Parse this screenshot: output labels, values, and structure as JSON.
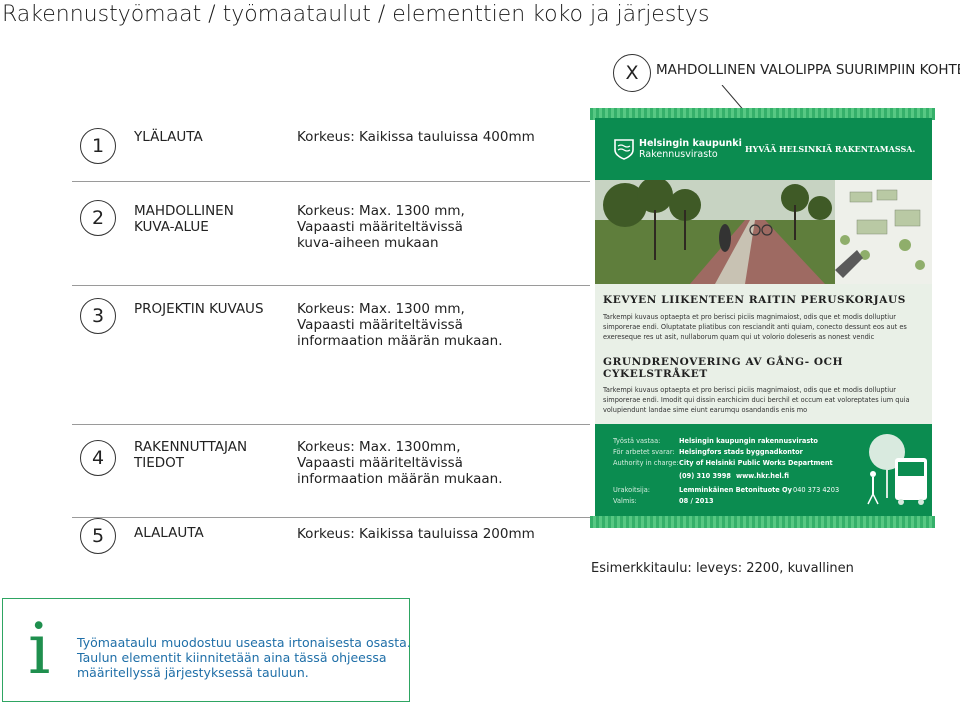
{
  "page": {
    "title": "Rakennustyömaat / työmaataulut / elementtien koko ja järjestys"
  },
  "optional": {
    "marker": "X",
    "label": "MAHDOLLINEN VALOLIPPA SUURIMPIIN KOHTEISIIN"
  },
  "rows": [
    {
      "num": "1",
      "label": [
        "YLÄLAUTA"
      ],
      "desc": [
        "Korkeus: Kaikissa tauluissa 400mm"
      ]
    },
    {
      "num": "2",
      "label": [
        "MAHDOLLINEN",
        "KUVA-ALUE"
      ],
      "desc": [
        "Korkeus: Max. 1300 mm,",
        "Vapaasti määriteltävissä",
        "kuva-aiheen mukaan"
      ]
    },
    {
      "num": "3",
      "label": [
        "PROJEKTIN KUVAUS"
      ],
      "desc": [
        "Korkeus: Max. 1300 mm,",
        "Vapaasti määriteltävissä",
        "informaation määrän mukaan."
      ]
    },
    {
      "num": "4",
      "label": [
        "RAKENNUTTAJAN",
        "TIEDOT"
      ],
      "desc": [
        "Korkeus: Max. 1300mm,",
        "Vapaasti määriteltävissä",
        "informaation määrän mukaan."
      ]
    },
    {
      "num": "5",
      "label": [
        "ALALAUTA"
      ],
      "desc": [
        "Korkeus: Kaikissa tauluissa 200mm"
      ]
    }
  ],
  "sign": {
    "logo_line1": "Helsingin kaupunki",
    "logo_line2": "Rakennusvirasto",
    "slogan": "HYVÄÄ HELSINKIÄ RAKENTAMASSA.",
    "heading_fi": "KEVYEN LIIKENTEEN RAITIN PERUSKORJAUS",
    "text_fi": "Tarkempi kuvaus optaepta et pro berisci piciis magnimaiost, odis que et modis dolluptiur simporerae endi. Oluptatate pliatibus con resciandit anti quiam, conecto dessunt eos aut es exereseque res ut asit, nullaborum quam qui ut volorio doleseris as nonest vendic",
    "heading_sv": "GRUNDRENOVERING AV GÅNG- OCH CYKELSTRÅKET",
    "text_sv": "Tarkempi kuvaus optaepta et pro berisci piciis magnimaiost, odis que et modis dolluptiur simporerae endi. Imodit qui dissin earchicim duci berchil et occum eat voloreptates ium quia volupiendunt landae sime eiunt earumqu osandandis enis mo",
    "info": [
      {
        "key": "Työstä vastaa:",
        "value": "Helsingin kaupungin rakennusvirasto"
      },
      {
        "key": "För arbetet svarar:",
        "value": "Helsingfors stads byggnadkontor"
      },
      {
        "key": "Authority in charge:",
        "value": "City of Helsinki Public Works Department"
      }
    ],
    "phone": "(09) 310 3998",
    "web": "www.hkr.hel.fi",
    "contractor_key": "Urakoitsija:",
    "contractor": "Lemminkäinen Betonituote Oy",
    "contractor_phone": "040 373 4203",
    "ready_key": "Valmis:",
    "ready": "08 / 2013",
    "sep": "/"
  },
  "caption": "Esimerkkitaulu: leveys: 2200, kuvallinen",
  "note": {
    "icon": "i",
    "lines": [
      "Työmaataulu muodostuu useasta irtonaisesta osasta.",
      "Taulun elementit kiinnitetään aina tässä ohjeessa",
      "määritellyssä järjestyksessä tauluun."
    ]
  },
  "colors": {
    "green": "#0b8c50",
    "light_panel": "#e9f0e7",
    "info_text": "#1f6fa8"
  }
}
